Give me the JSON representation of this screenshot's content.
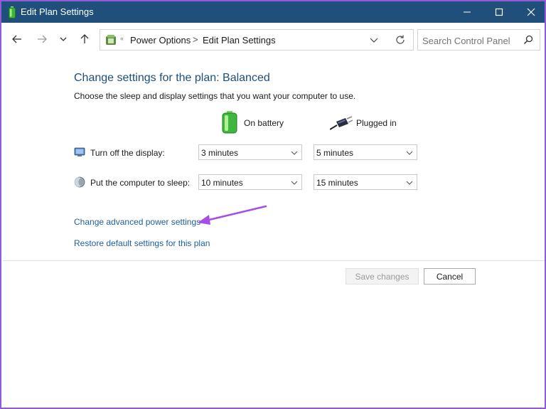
{
  "window": {
    "title": "Edit Plan Settings",
    "frame_color": "#8f5bd6",
    "titlebar_color": "#1f4f7a"
  },
  "address": {
    "crumbs": [
      "Power Options",
      "Edit Plan Settings"
    ],
    "separator": ">"
  },
  "search": {
    "placeholder": "Search Control Panel"
  },
  "main": {
    "title": "Change settings for the plan: Balanced",
    "description": "Choose the sleep and display settings that you want your computer to use.",
    "columns": {
      "battery": "On battery",
      "plugged": "Plugged in"
    },
    "rows": [
      {
        "label": "Turn off the display:",
        "icon": "display-icon",
        "battery": "3 minutes",
        "plugged": "5 minutes"
      },
      {
        "label": "Put the computer to sleep:",
        "icon": "sleep-moon-icon",
        "battery": "10 minutes",
        "plugged": "15 minutes"
      }
    ],
    "links": {
      "advanced": "Change advanced power settings",
      "restore": "Restore default settings for this plan"
    }
  },
  "buttons": {
    "save": "Save changes",
    "cancel": "Cancel"
  },
  "colors": {
    "link": "#1e5e9c",
    "heading": "#1e4f7a",
    "annotation_arrow": "#a64ee6"
  }
}
